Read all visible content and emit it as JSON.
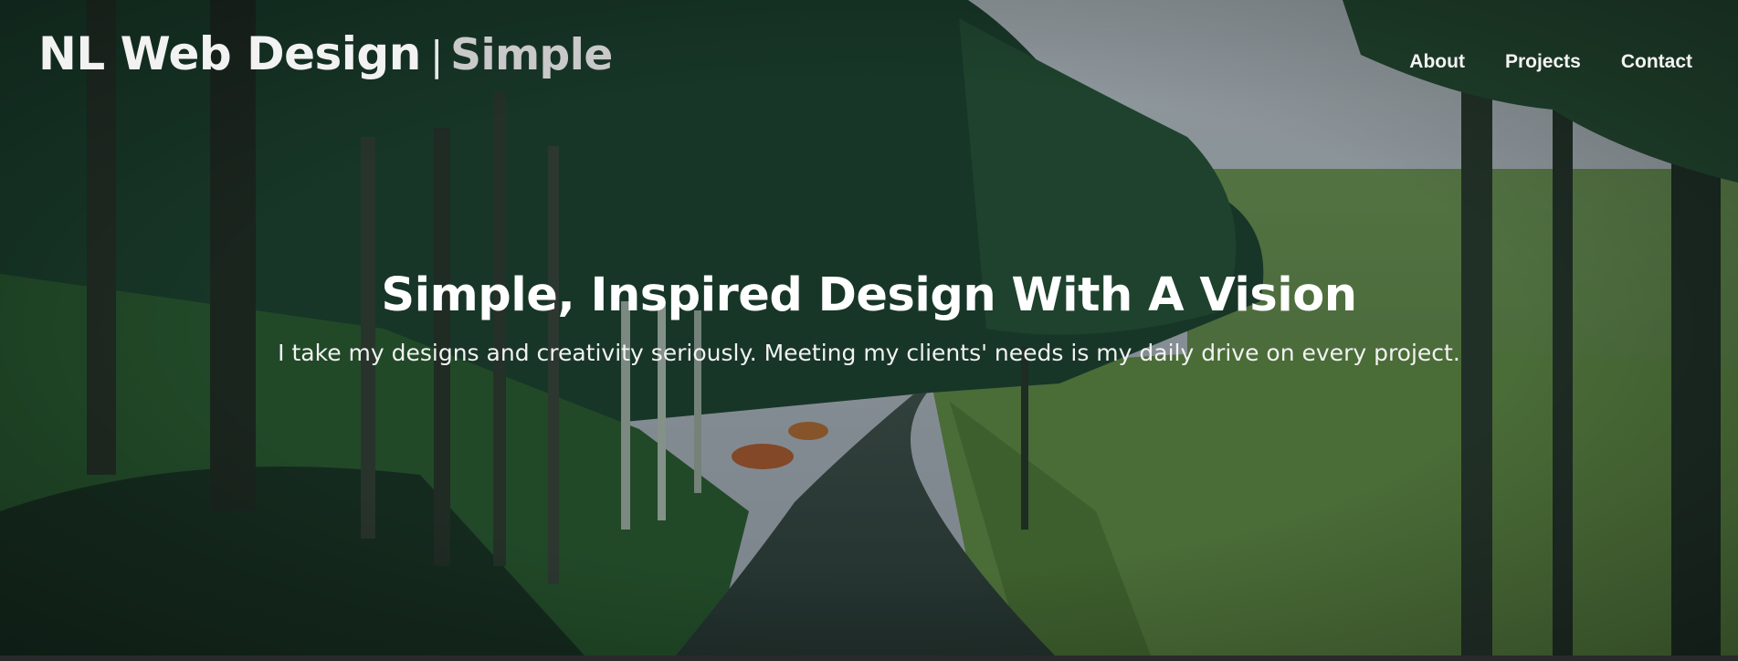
{
  "header": {
    "brand": "NL Web Design",
    "separator": "|",
    "brand_sub": "Simple"
  },
  "nav": {
    "items": [
      {
        "label": "About"
      },
      {
        "label": "Projects"
      },
      {
        "label": "Contact"
      }
    ]
  },
  "hero": {
    "headline": "Simple, Inspired Design With A Vision",
    "tagline": "I take my designs and creativity seriously. Meeting my clients' needs is my daily drive on every project.",
    "background_image": "forest-road-landscape"
  },
  "colors": {
    "text": "#ffffff",
    "brand_sub": "#c9c9c9",
    "overlay": "#0a2a22"
  }
}
